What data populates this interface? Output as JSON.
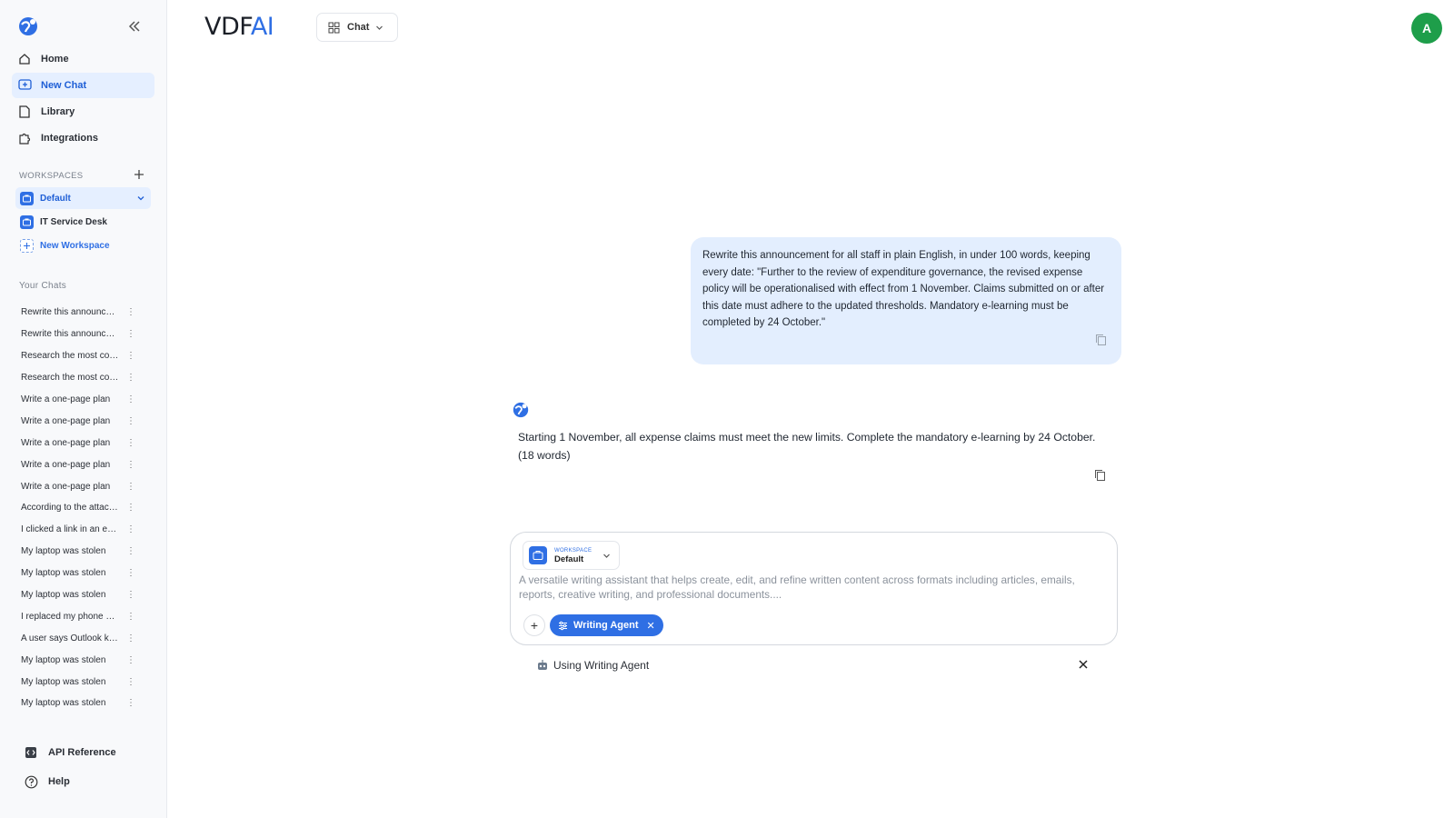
{
  "app": {
    "brand_prefix": "VDF",
    "brand_suffix": "AI",
    "accent": "#2f6fe4"
  },
  "sidebar": {
    "nav": [
      {
        "label": "Home",
        "icon": "home-icon"
      },
      {
        "label": "New Chat",
        "icon": "new-chat-icon"
      },
      {
        "label": "Library",
        "icon": "file-icon"
      },
      {
        "label": "Integrations",
        "icon": "puzzle-icon"
      }
    ],
    "workspaces_label": "WORKSPACES",
    "workspaces": [
      {
        "label": "Default"
      },
      {
        "label": "IT Service Desk"
      },
      {
        "label": "New Workspace"
      }
    ],
    "your_chats_label": "Your Chats",
    "chats": [
      "Rewrite this announcement for all staff in plain English",
      "Rewrite this announcement for all staff in plain English",
      "Research the most common causes",
      "Research the most common causes",
      "Write a one-page plan",
      "Write a one-page plan",
      "Write a one-page plan",
      "Write a one-page plan",
      "Write a one-page plan",
      "According to the attached document",
      "I clicked a link in an email",
      "My laptop was stolen",
      "My laptop was stolen",
      "My laptop was stolen",
      "I replaced my phone and",
      "A user says Outlook keeps",
      "My laptop was stolen",
      "My laptop was stolen",
      "My laptop was stolen"
    ],
    "bottom": [
      {
        "label": "API Reference",
        "icon": "api-icon"
      },
      {
        "label": "Help",
        "icon": "help-icon"
      }
    ]
  },
  "header": {
    "mode": "Chat",
    "avatar_initial": "A"
  },
  "messages": {
    "user": " Rewrite this announcement for all staff in plain English, in under 100 words, keeping every date: \"Further to the review of expenditure governance, the revised expense policy will be operationalised with effect from 1 November. Claims submitted on or after this date must adhere to the updated thresholds. Mandatory e-learning must be completed by 24 October.\"",
    "assistant": "Starting 1 November, all expense claims must meet the new limits. Complete the mandatory e-learning by 24 October. (18 words)"
  },
  "composer": {
    "workspace_label": "WORKSPACE",
    "workspace_name": "Default",
    "placeholder": "A versatile writing assistant that helps create, edit, and refine written content across formats including articles, emails, reports, creative writing, and professional documents....",
    "agent_pill": "Writing Agent",
    "using_text": "Using Writing Agent"
  }
}
